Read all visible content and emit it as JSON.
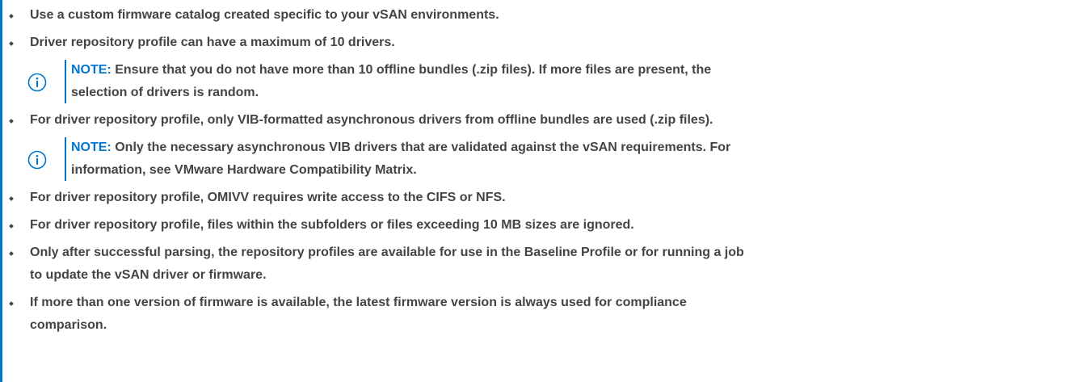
{
  "list": {
    "items": [
      {
        "text": "Use a custom firmware catalog created specific to your vSAN environments."
      },
      {
        "text": "Driver repository profile can have a maximum of 10 drivers.",
        "note": {
          "label": "NOTE:",
          "line1": "Ensure that you do not have more than 10 offline bundles (.zip files). If more files are present, the",
          "line2": "selection of drivers is random."
        }
      },
      {
        "text": "For driver repository profile, only VIB-formatted asynchronous drivers from offline bundles are used (.zip files).",
        "note": {
          "label": "NOTE:",
          "line1": "Only the necessary asynchronous VIB drivers that are validated against the vSAN requirements. For",
          "line2": "information, see VMware Hardware Compatibility Matrix."
        }
      },
      {
        "text": "For driver repository profile, OMIVV requires write access to the CIFS or NFS."
      },
      {
        "text": "For driver repository profile, files within the subfolders or files exceeding 10 MB sizes are ignored."
      },
      {
        "line1": "Only after successful parsing, the repository profiles are available for use in the Baseline Profile or for running a job",
        "line2": "to update the vSAN driver or firmware."
      },
      {
        "line1": "If more than one version of firmware is available, the latest firmware version is always used for compliance",
        "line2": "comparison."
      }
    ]
  },
  "colors": {
    "accent": "#0076ce",
    "text": "#444444"
  },
  "icons": {
    "note": "info-circle-icon",
    "bullet": "diamond-bullet-icon"
  }
}
